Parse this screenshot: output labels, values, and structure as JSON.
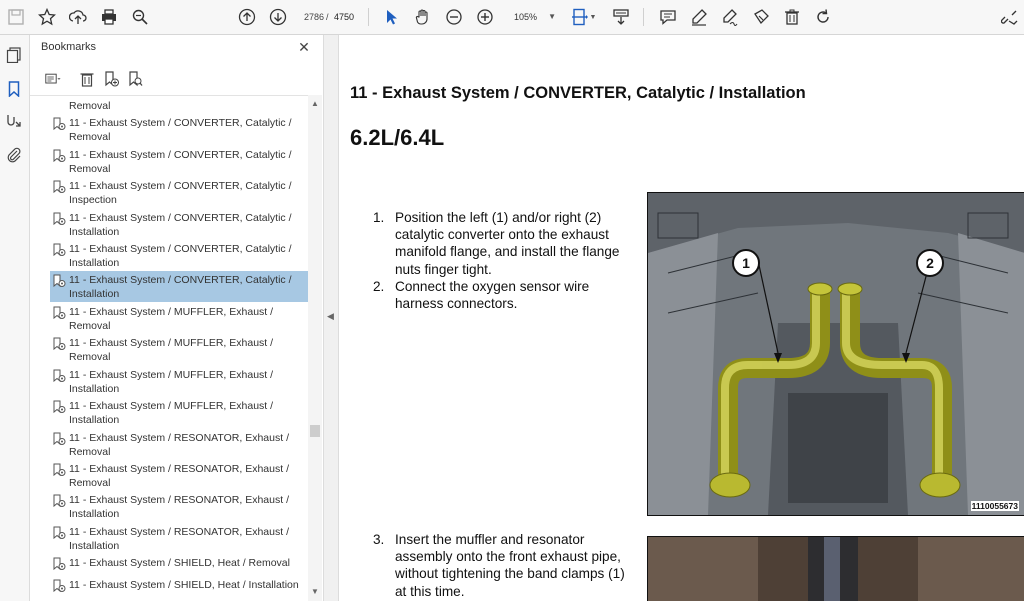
{
  "toolbar": {
    "page_current": "2786",
    "page_separator": "/",
    "page_total": "4750",
    "zoom": "105%",
    "icons": [
      "save-icon",
      "bookmark-star-icon",
      "upload-icon",
      "print-icon",
      "zoom-search-icon",
      "page-up-icon",
      "page-down-icon",
      "select-cursor-icon",
      "hand-icon",
      "zoom-out-icon",
      "zoom-in-icon",
      "fit-page-icon",
      "scroll-mode-icon",
      "comment-icon",
      "highlight-pen-icon",
      "sign-icon",
      "stamp-icon",
      "delete-icon",
      "rotate-icon",
      "share-link-icon"
    ]
  },
  "rail": {
    "icons": [
      "pages-icon",
      "bookmarks-icon",
      "attachment-signature-icon",
      "paperclip-icon"
    ]
  },
  "bookmarks": {
    "title": "Bookmarks",
    "close": "✕",
    "items": [
      {
        "text": "Removal",
        "selected": false
      },
      {
        "text": "11 - Exhaust System / CONVERTER, Catalytic / Removal",
        "selected": false
      },
      {
        "text": "11 - Exhaust System / CONVERTER, Catalytic / Removal",
        "selected": false
      },
      {
        "text": "11 - Exhaust System / CONVERTER, Catalytic / Inspection",
        "selected": false
      },
      {
        "text": "11 - Exhaust System / CONVERTER, Catalytic / Installation",
        "selected": false
      },
      {
        "text": "11 - Exhaust System / CONVERTER, Catalytic / Installation",
        "selected": false
      },
      {
        "text": "11 - Exhaust System / CONVERTER, Catalytic / Installation",
        "selected": true
      },
      {
        "text": "11 - Exhaust System / MUFFLER, Exhaust / Removal",
        "selected": false
      },
      {
        "text": "11 - Exhaust System / MUFFLER, Exhaust / Removal",
        "selected": false
      },
      {
        "text": "11 - Exhaust System / MUFFLER, Exhaust / Installation",
        "selected": false
      },
      {
        "text": "11 - Exhaust System / MUFFLER, Exhaust / Installation",
        "selected": false
      },
      {
        "text": "11 - Exhaust System / RESONATOR, Exhaust / Removal",
        "selected": false
      },
      {
        "text": "11 - Exhaust System / RESONATOR, Exhaust / Removal",
        "selected": false
      },
      {
        "text": "11 - Exhaust System / RESONATOR, Exhaust / Installation",
        "selected": false
      },
      {
        "text": "11 - Exhaust System / RESONATOR, Exhaust / Installation",
        "selected": false
      },
      {
        "text": "11 - Exhaust System / SHIELD, Heat / Removal",
        "selected": false
      },
      {
        "text": "11 - Exhaust System / SHIELD, Heat / Installation",
        "selected": false
      }
    ]
  },
  "document": {
    "title": "11 - Exhaust System / CONVERTER, Catalytic / Installation",
    "subtitle": "6.2L/6.4L",
    "steps": [
      {
        "num": "1.",
        "text": "Position the left (1) and/or right (2) catalytic converter onto the exhaust manifold flange, and install the flange nuts finger tight."
      },
      {
        "num": "2.",
        "text": "Connect the oxygen sensor wire harness connectors."
      },
      {
        "num": "3.",
        "text": "Insert the muffler and resonator assembly onto the front exhaust pipe, without tightening the band clamps (1) at this time."
      }
    ],
    "figure1": {
      "code": "1110055673",
      "callouts": [
        "1",
        "2"
      ]
    }
  }
}
